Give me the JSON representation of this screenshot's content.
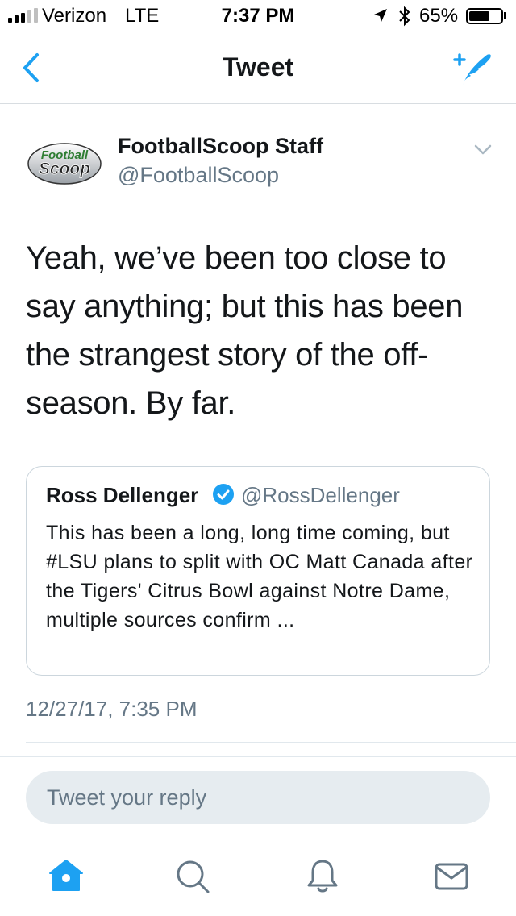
{
  "status_bar": {
    "carrier": "Verizon",
    "network": "LTE",
    "time": "7:37 PM",
    "battery_percent": "65%",
    "battery_level": 0.65,
    "icons": [
      "signal-icon",
      "location-arrow-icon",
      "bluetooth-icon",
      "battery-icon"
    ]
  },
  "nav": {
    "title": "Tweet",
    "back_icon": "chevron-left-icon",
    "compose_icon": "compose-tweet-icon"
  },
  "tweet": {
    "avatar_text_line1": "Football",
    "avatar_text_line2": "Scoop",
    "author_name": "FootballScoop Staff",
    "author_handle": "@FootballScoop",
    "text": "Yeah, we’ve been too close to say anything; but this has been the strangest story of the off-season. By far.",
    "timestamp": "12/27/17, 7:35 PM"
  },
  "quoted_tweet": {
    "author_name": "Ross Dellenger",
    "author_handle": "@RossDellenger",
    "verified": true,
    "text": "This has been a long, long time coming, but #LSU plans to split with OC Matt Canada after the Tigers' Citrus Bowl against Notre Dame, multiple sources confirm ..."
  },
  "reply": {
    "placeholder": "Tweet your reply"
  },
  "tab_bar": [
    {
      "name": "home",
      "icon": "home-icon",
      "active": true
    },
    {
      "name": "search",
      "icon": "search-icon",
      "active": false
    },
    {
      "name": "notifications",
      "icon": "bell-icon",
      "active": false
    },
    {
      "name": "messages",
      "icon": "envelope-icon",
      "active": false
    }
  ],
  "colors": {
    "accent": "#1da1f2",
    "text_primary": "#14171a",
    "text_secondary": "#657786",
    "border": "#ccd6dd",
    "reply_bg": "#e6ecf0"
  }
}
